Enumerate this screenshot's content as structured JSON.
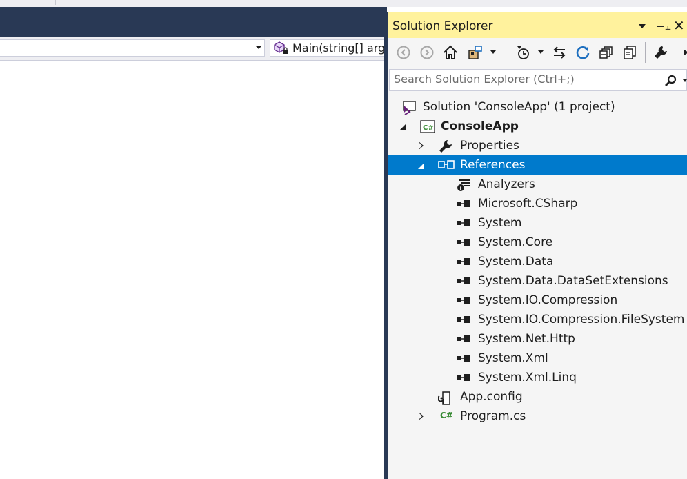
{
  "navbar": {
    "member_label": "Main(string[] args)"
  },
  "solution_explorer": {
    "title": "Solution Explorer",
    "pin_glyph": "−⫠",
    "close_glyph": "✕",
    "toolbar": {
      "icons": [
        "back-icon",
        "forward-icon",
        "home-icon",
        "switch-views-icon",
        "pending-changes-filter-icon",
        "sync-with-active-document-icon",
        "refresh-icon",
        "collapse-all-icon",
        "show-all-files-icon",
        "properties-icon"
      ]
    },
    "search": {
      "placeholder": "Search Solution Explorer (Ctrl+;)"
    },
    "tree": {
      "solution": "Solution 'ConsoleApp' (1 project)",
      "project": "ConsoleApp",
      "properties": "Properties",
      "references": "References",
      "reference_items": [
        "Analyzers",
        "Microsoft.CSharp",
        "System",
        "System.Core",
        "System.Data",
        "System.Data.DataSetExtensions",
        "System.IO.Compression",
        "System.IO.Compression.FileSystem",
        "System.Net.Http",
        "System.Xml",
        "System.Xml.Linq"
      ],
      "app_config": "App.config",
      "program_cs": "Program.cs",
      "csharp_badge": "C#"
    }
  },
  "colors": {
    "title_bar": "#fff29d",
    "selection": "#007acc",
    "dark_chrome": "#293955",
    "panel_bg": "#f5f5f5"
  }
}
